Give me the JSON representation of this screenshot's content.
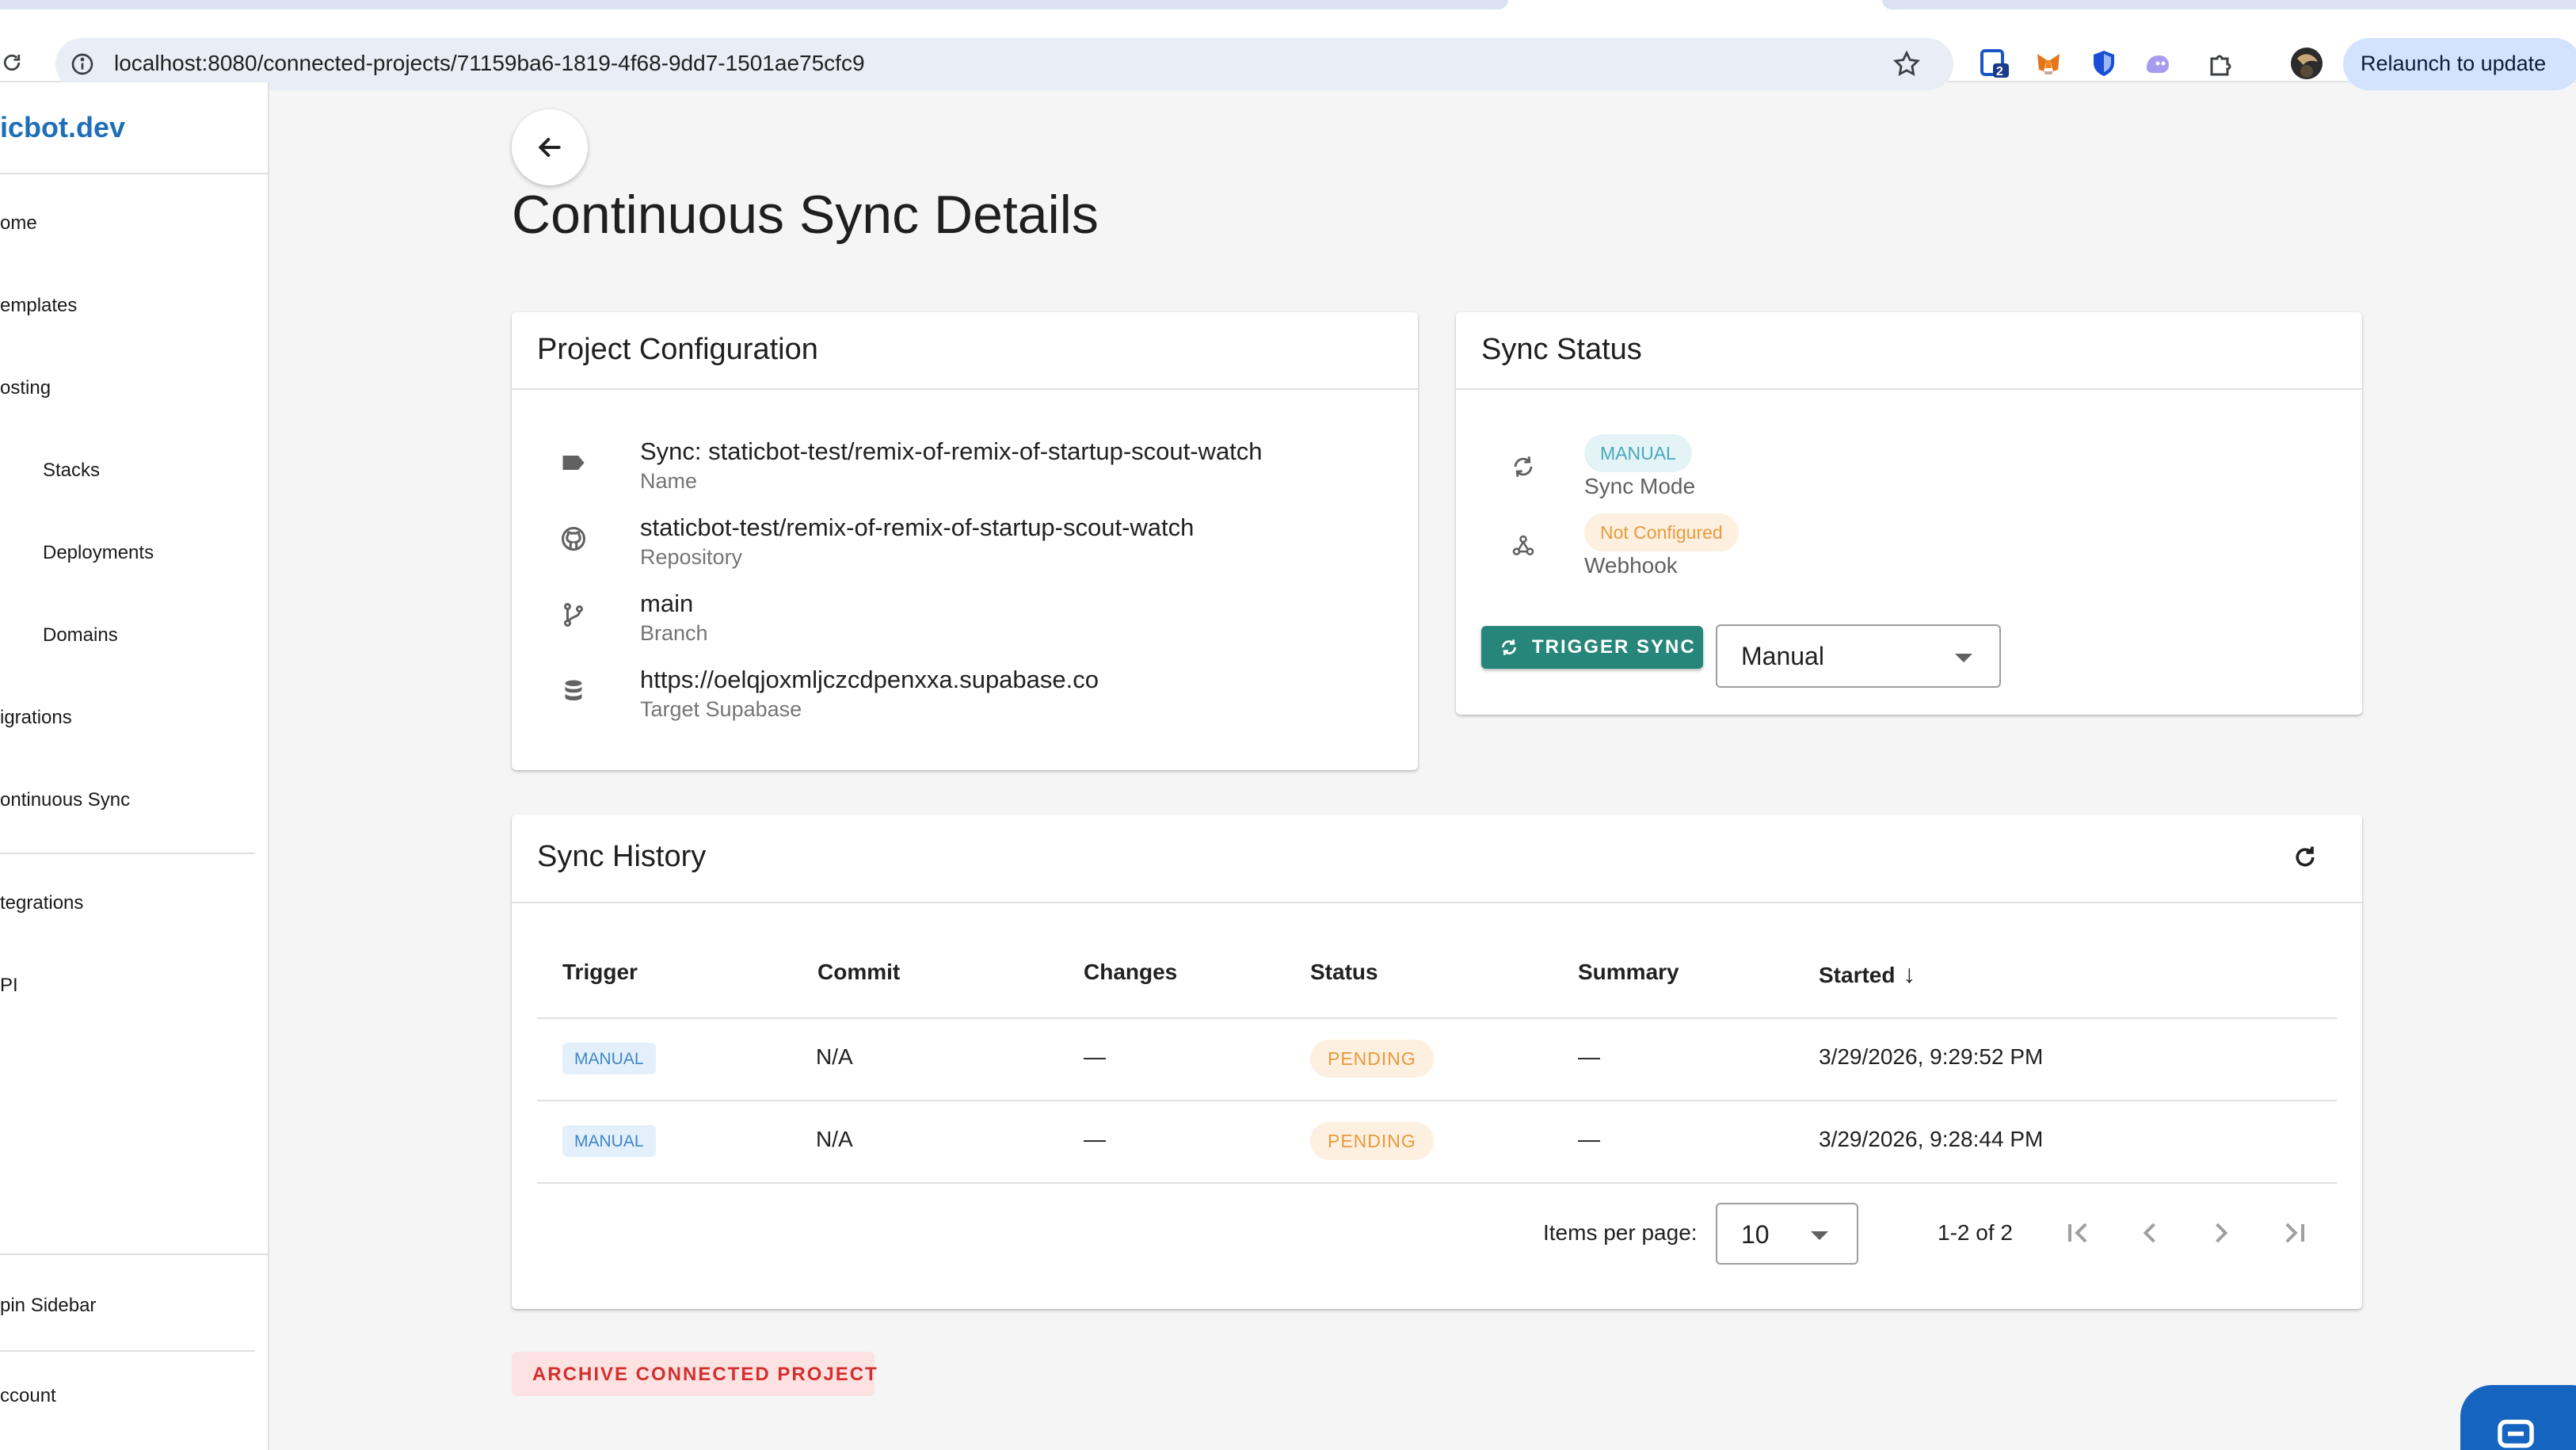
{
  "browser": {
    "url": "localhost:8080/connected-projects/71159ba6-1819-4f68-9dd7-1501ae75cfc9",
    "extension_badge_count": "2",
    "relaunch_label": "Relaunch to update"
  },
  "sidebar": {
    "brand": "icbot.dev",
    "items": [
      {
        "label": "ome"
      },
      {
        "label": "emplates"
      },
      {
        "label": "osting"
      },
      {
        "label": "Stacks"
      },
      {
        "label": "Deployments"
      },
      {
        "label": "Domains"
      },
      {
        "label": "igrations"
      },
      {
        "label": "ontinuous Sync"
      },
      {
        "label": "tegrations"
      },
      {
        "label": "PI"
      },
      {
        "label": "pin Sidebar"
      },
      {
        "label": "ccount"
      }
    ]
  },
  "page": {
    "title": "Continuous Sync Details"
  },
  "project_config": {
    "title": "Project Configuration",
    "rows": [
      {
        "icon": "label-icon",
        "value": "Sync: staticbot-test/remix-of-remix-of-startup-scout-watch",
        "label": "Name"
      },
      {
        "icon": "github-icon",
        "value": "staticbot-test/remix-of-remix-of-startup-scout-watch",
        "label": "Repository"
      },
      {
        "icon": "branch-icon",
        "value": "main",
        "label": "Branch"
      },
      {
        "icon": "database-icon",
        "value": "https://oelqjoxmljczcdpenxxa.supabase.co",
        "label": "Target Supabase"
      }
    ]
  },
  "sync_status": {
    "title": "Sync Status",
    "mode_chip": "MANUAL",
    "mode_label": "Sync Mode",
    "webhook_chip": "Not Configured",
    "webhook_label": "Webhook",
    "trigger_label": "TRIGGER SYNC",
    "mode_select_value": "Manual"
  },
  "history": {
    "title": "Sync History",
    "columns": [
      "Trigger",
      "Commit",
      "Changes",
      "Status",
      "Summary",
      "Started"
    ],
    "sort_indicator": "↓",
    "rows": [
      {
        "trigger": "MANUAL",
        "commit": "N/A",
        "changes": "—",
        "status": "PENDING",
        "summary": "—",
        "started": "3/29/2026, 9:29:52 PM"
      },
      {
        "trigger": "MANUAL",
        "commit": "N/A",
        "changes": "—",
        "status": "PENDING",
        "summary": "—",
        "started": "3/29/2026, 9:28:44 PM"
      }
    ],
    "items_per_page_label": "Items per page:",
    "items_per_page_value": "10",
    "range_label": "1-2 of 2"
  },
  "actions": {
    "archive_label": "ARCHIVE CONNECTED PROJECT"
  },
  "colors": {
    "accent_teal": "#26867a",
    "brand_blue": "#1e6fb8",
    "pending_orange": "#e89a3c",
    "danger_red": "#d32f2f"
  }
}
